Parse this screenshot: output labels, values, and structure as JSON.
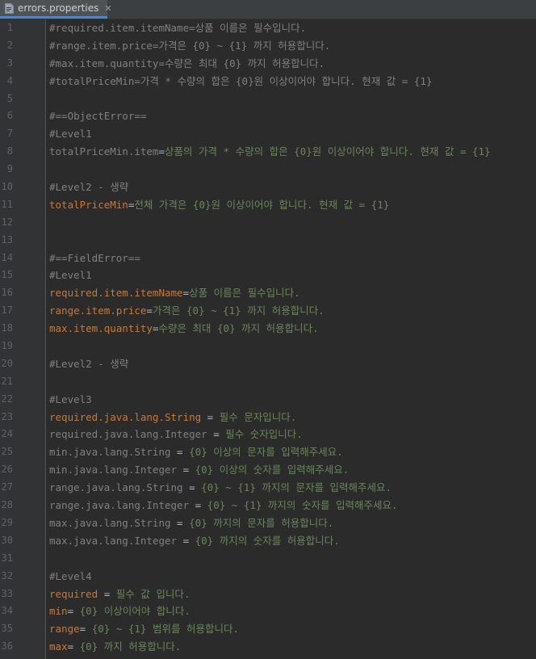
{
  "tab": {
    "label": "errors.properties",
    "close": "✕",
    "icon": "properties-file-icon"
  },
  "colors": {
    "comment": "#808080",
    "key": "#cc7832",
    "value": "#6a8759",
    "plain": "#a9b7c6",
    "background": "#2b2b2b",
    "gutter": "#313335"
  },
  "lines": [
    {
      "n": "1",
      "type": "comment",
      "text": "#required.item.itemName=상품 이름은 필수입니다."
    },
    {
      "n": "2",
      "type": "comment",
      "text": "#range.item.price=가격은 {0} ~ {1} 까지 허용합니다."
    },
    {
      "n": "3",
      "type": "comment",
      "text": "#max.item.quantity=수량은 최대 {0} 까지 허용합니다."
    },
    {
      "n": "4",
      "type": "comment",
      "text": "#totalPriceMin=가격 * 수량의 합은 {0}원 이상이어야 합니다. 현재 값 = {1}"
    },
    {
      "n": "5",
      "type": "blank",
      "text": ""
    },
    {
      "n": "6",
      "type": "comment",
      "text": "#==ObjectError=="
    },
    {
      "n": "7",
      "type": "comment",
      "text": "#Level1"
    },
    {
      "n": "8",
      "type": "kv",
      "key": "totalPriceMin.item",
      "sep": "=",
      "value": "상품의 가격 * 수량의 합은 {0}원 이상이어야 합니다. 현재 값 = {1}",
      "keyStyle": "dim"
    },
    {
      "n": "9",
      "type": "blank",
      "text": ""
    },
    {
      "n": "10",
      "type": "comment",
      "text": "#Level2 - 생략"
    },
    {
      "n": "11",
      "type": "kv",
      "key": "totalPriceMin",
      "sep": "=",
      "value": "전체 가격은 {0}원 이상이어야 합니다. 현재 값 = {1}",
      "keyStyle": "key"
    },
    {
      "n": "12",
      "type": "blank",
      "text": ""
    },
    {
      "n": "13",
      "type": "blank",
      "text": ""
    },
    {
      "n": "14",
      "type": "comment",
      "text": "#==FieldError=="
    },
    {
      "n": "15",
      "type": "comment",
      "text": "#Level1"
    },
    {
      "n": "16",
      "type": "kv",
      "key": "required.item.itemName",
      "sep": "=",
      "value": "상품 이름은 필수입니다.",
      "keyStyle": "key"
    },
    {
      "n": "17",
      "type": "kv",
      "key": "range.item.price",
      "sep": "=",
      "value": "가격은 {0} ~ {1} 까지 허용합니다.",
      "keyStyle": "key"
    },
    {
      "n": "18",
      "type": "kv",
      "key": "max.item.quantity",
      "sep": "=",
      "value": "수량은 최대 {0} 까지 허용합니다.",
      "keyStyle": "key"
    },
    {
      "n": "19",
      "type": "blank",
      "text": ""
    },
    {
      "n": "20",
      "type": "comment",
      "text": "#Level2 - 생략"
    },
    {
      "n": "21",
      "type": "blank",
      "text": ""
    },
    {
      "n": "22",
      "type": "comment",
      "text": "#Level3"
    },
    {
      "n": "23",
      "type": "kv",
      "key": "required.java.lang.String",
      "sep": " = ",
      "value": "필수 문자입니다.",
      "keyStyle": "key"
    },
    {
      "n": "24",
      "type": "kv",
      "key": "required.java.lang.Integer",
      "sep": " = ",
      "value": "필수 숫자입니다.",
      "keyStyle": "dim"
    },
    {
      "n": "25",
      "type": "kv",
      "key": "min.java.lang.String",
      "sep": " = ",
      "value": "{0} 이상의 문자를 입력해주세요.",
      "keyStyle": "dim"
    },
    {
      "n": "26",
      "type": "kv",
      "key": "min.java.lang.Integer",
      "sep": " = ",
      "value": "{0} 이상의 숫자를 입력해주세요.",
      "keyStyle": "dim"
    },
    {
      "n": "27",
      "type": "kv",
      "key": "range.java.lang.String",
      "sep": " = ",
      "value": "{0} ~ {1} 까지의 문자를 입력해주세요.",
      "keyStyle": "dim"
    },
    {
      "n": "28",
      "type": "kv",
      "key": "range.java.lang.Integer",
      "sep": " = ",
      "value": "{0} ~ {1} 까지의 숫자를 입력해주세요.",
      "keyStyle": "dim"
    },
    {
      "n": "29",
      "type": "kv",
      "key": "max.java.lang.String",
      "sep": " = ",
      "value": "{0} 까지의 문자를 허용합니다.",
      "keyStyle": "dim"
    },
    {
      "n": "30",
      "type": "kv",
      "key": "max.java.lang.Integer",
      "sep": " = ",
      "value": "{0} 까지의 숫자를 허용합니다.",
      "keyStyle": "dim"
    },
    {
      "n": "31",
      "type": "blank",
      "text": ""
    },
    {
      "n": "32",
      "type": "comment",
      "text": "#Level4"
    },
    {
      "n": "33",
      "type": "kv",
      "key": "required",
      "sep": " = ",
      "value": "필수 값 입니다.",
      "keyStyle": "key"
    },
    {
      "n": "34",
      "type": "kv",
      "key": "min",
      "sep": "= ",
      "value": "{0} 이상이어야 합니다.",
      "keyStyle": "key"
    },
    {
      "n": "35",
      "type": "kv",
      "key": "range",
      "sep": "= ",
      "value": "{0} ~ {1} 범위를 허용합니다.",
      "keyStyle": "key"
    },
    {
      "n": "36",
      "type": "kv",
      "key": "max",
      "sep": "= ",
      "value": "{0} 까지 허용합니다.",
      "keyStyle": "key"
    }
  ]
}
